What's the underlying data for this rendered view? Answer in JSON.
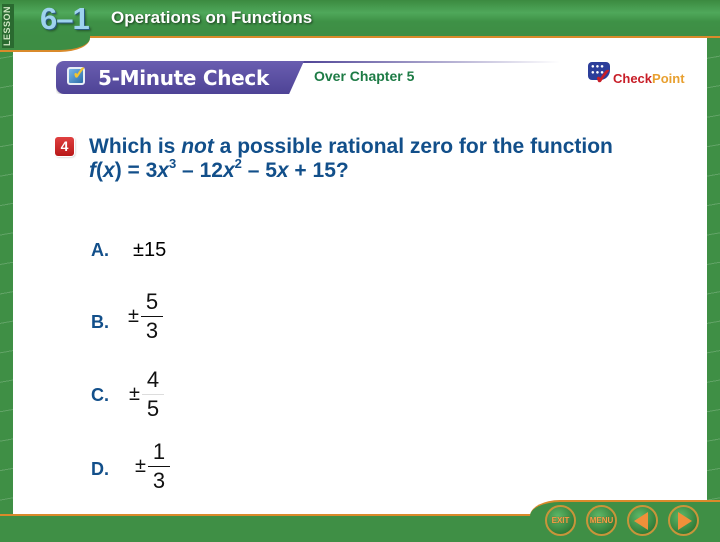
{
  "header": {
    "lesson_label": "LESSON",
    "lesson_number": "6–1",
    "lesson_title": "Operations on Functions"
  },
  "banner": {
    "title": "5-Minute Check",
    "check_icon": "checkbox-check-icon",
    "chapter": "Over Chapter 5"
  },
  "logo": {
    "check": "Check",
    "point": "Point",
    "colors": {
      "check": "#c81e28",
      "point": "#e8a030",
      "shield": "#2c3e9a"
    }
  },
  "question": {
    "number": "4",
    "text_before": "Which is ",
    "text_italic": "not",
    "text_after": " a possible rational zero for the function",
    "function_f": "f",
    "function_x": "x",
    "function_open": "(",
    "function_close": ") = 3",
    "term1_var": "x",
    "term1_exp": "3",
    "term2_prefix": " – 12",
    "term2_var": "x",
    "term2_exp": "2",
    "term3_prefix": " – 5",
    "term3_var": "x",
    "term3_suffix": " + 15?"
  },
  "choices": [
    {
      "letter": "A.",
      "value": "±15"
    },
    {
      "letter": "B.",
      "sign": "±",
      "numerator": "5",
      "denominator": "3"
    },
    {
      "letter": "C.",
      "sign": "±",
      "numerator": "4",
      "denominator": "5"
    },
    {
      "letter": "D.",
      "sign": "±",
      "numerator": "1",
      "denominator": "3"
    }
  ],
  "nav": {
    "exit": "EXIT",
    "menu": "MENU",
    "prev": "previous-icon",
    "next": "next-icon"
  },
  "colors": {
    "frame_green": "#3f8f45",
    "accent_orange": "#d98a2b",
    "banner_purple": "#4e4396",
    "question_blue": "#124f8a",
    "chapter_green": "#1d7b45",
    "badge_red": "#c81e28"
  }
}
